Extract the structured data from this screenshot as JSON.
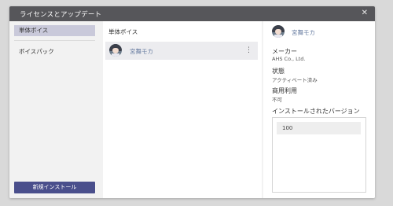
{
  "dialog": {
    "title": "ライセンスとアップデート",
    "close_glyph": "✕"
  },
  "sidebar": {
    "items": [
      {
        "label": "単体ボイス",
        "active": true
      },
      {
        "label": "ボイスパック",
        "active": false
      }
    ],
    "install_button_label": "新規インストール"
  },
  "list": {
    "header": "単体ボイス",
    "rows": [
      {
        "name": "宮舞モカ",
        "avatar": "moka-avatar",
        "menu_glyph": "⋮"
      }
    ]
  },
  "detail": {
    "name": "宮舞モカ",
    "avatar": "moka-avatar",
    "fields": [
      {
        "label": "メーカー",
        "value": "AHS Co., Ltd."
      },
      {
        "label": "状態",
        "value": "アクティベート済み"
      },
      {
        "label": "商用利用",
        "value": "不可"
      }
    ],
    "versions_label": "インストールされたバージョン",
    "versions": [
      "100"
    ]
  },
  "colors": {
    "titlebar": "#56565a",
    "accent_button": "#4a4f8c",
    "selected_nav": "#c9c9da",
    "name_link": "#6b7fa3"
  }
}
